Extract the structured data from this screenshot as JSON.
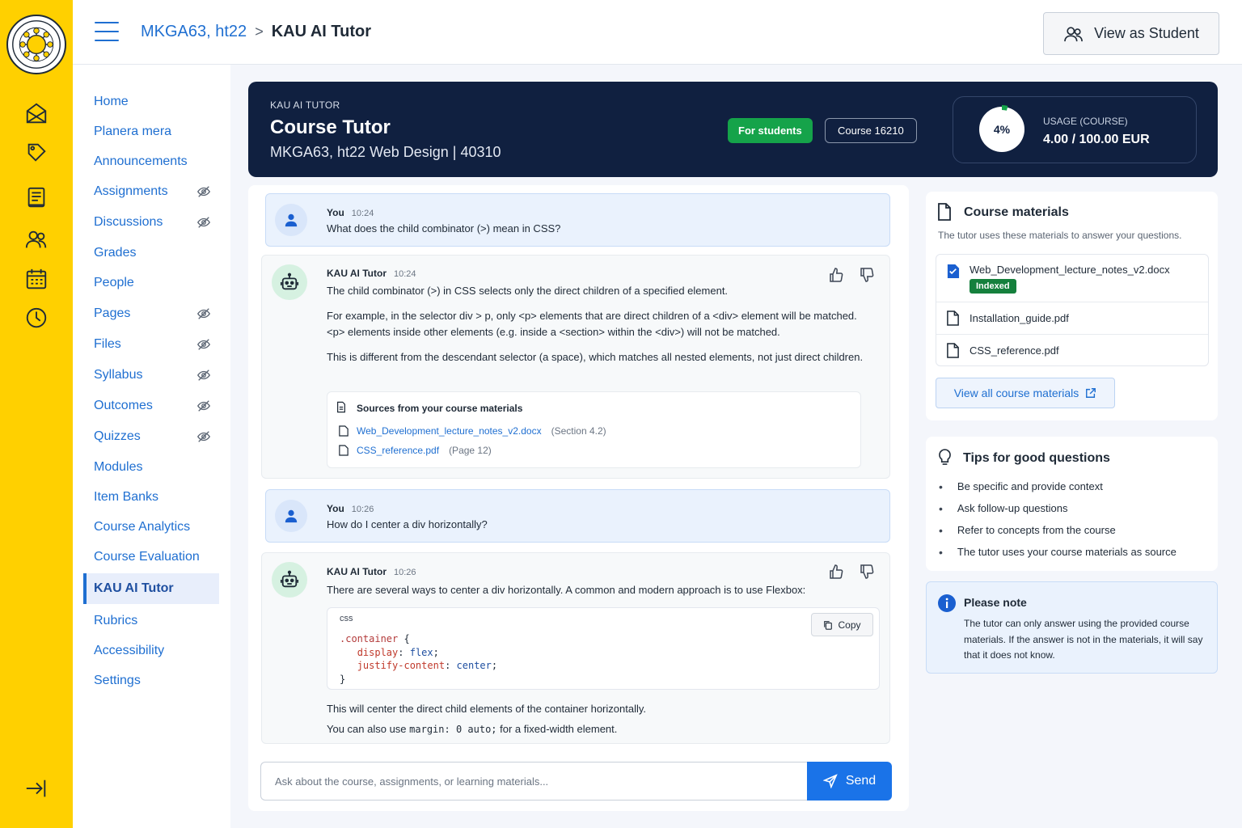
{
  "header": {
    "breadcrumb_course": "MKGA63, ht22",
    "breadcrumb_separator": ">",
    "breadcrumb_current": "KAU AI Tutor",
    "view_as_student": "View as Student"
  },
  "rail": {
    "icons": [
      "account-icon",
      "admin-icon",
      "dashboard-icon",
      "courses-icon",
      "groups-icon",
      "calendar-icon",
      "history-icon",
      "collapse-icon"
    ]
  },
  "course_nav": {
    "items": [
      {
        "label": "Home",
        "hidden": false
      },
      {
        "label": "Planera mera",
        "hidden": false
      },
      {
        "label": "Announcements",
        "hidden": false
      },
      {
        "label": "Assignments",
        "hidden": true
      },
      {
        "label": "Discussions",
        "hidden": true
      },
      {
        "label": "Grades",
        "hidden": false
      },
      {
        "label": "People",
        "hidden": false
      },
      {
        "label": "Pages",
        "hidden": true
      },
      {
        "label": "Files",
        "hidden": true
      },
      {
        "label": "Syllabus",
        "hidden": true
      },
      {
        "label": "Outcomes",
        "hidden": true
      },
      {
        "label": "Quizzes",
        "hidden": true
      },
      {
        "label": "Modules",
        "hidden": false
      },
      {
        "label": "Item Banks",
        "hidden": false
      },
      {
        "label": "Course Analytics",
        "hidden": false
      },
      {
        "label": "Course Evaluation",
        "hidden": false
      },
      {
        "label": "KAU AI Tutor",
        "hidden": false,
        "active": true
      },
      {
        "label": "Rubrics",
        "hidden": false
      },
      {
        "label": "Accessibility",
        "hidden": false
      },
      {
        "label": "Settings",
        "hidden": false
      }
    ]
  },
  "hero": {
    "kicker": "KAU AI TUTOR",
    "title": "Course Tutor",
    "subtitle": "MKGA63, ht22 Web Design | 40310",
    "badge_students": "For students",
    "badge_course": "Course 16210",
    "usage_percent_label": "4%",
    "usage_fraction": 0.04,
    "usage_label": "USAGE (COURSE)",
    "usage_value": "4.00 / 100.00 EUR"
  },
  "chat": {
    "messages": [
      {
        "author": "You",
        "time": "10:24",
        "text": "What does the child combinator (>) mean in CSS?"
      },
      {
        "author": "KAU AI Tutor",
        "time": "10:24",
        "p1": "The child combinator (>) in CSS selects only the direct children of a specified element.",
        "p2": "For example, in the selector div > p, only <p> elements that are direct children of a <div> element will be matched. <p> elements inside other elements (e.g. inside a <section> within the <div>) will not be matched.",
        "p3": "This is different from the descendant selector (a space), which matches all nested elements, not just direct children.",
        "sources_title": "Sources from your course materials",
        "sources": [
          {
            "file": "Web_Development_lecture_notes_v2.docx",
            "note": "(Section 4.2)"
          },
          {
            "file": "CSS_reference.pdf",
            "note": "(Page 12)"
          }
        ]
      },
      {
        "author": "You",
        "time": "10:26",
        "text": "How do I center a div horizontally?"
      },
      {
        "author": "KAU AI Tutor",
        "time": "10:26",
        "p1_a": "There are several ways to center a ",
        "p1_b": "div",
        "p1_c": " horizontally. A common and modern approach is to use Flexbox:",
        "code_lang": "css",
        "copy_label": "Copy",
        "code": {
          "selector": ".container",
          "open": " {",
          "prop1": "display",
          "val1": "flex",
          "prop2": "justify-content",
          "val2": "center",
          "close": "}"
        },
        "p2": "This will center the direct child elements of the container horizontally.",
        "p3_a": "You can also use ",
        "p3_code": "margin: 0 auto;",
        "p3_b": " for a fixed-width element."
      }
    ],
    "input_placeholder": "Ask about the course, assignments, or learning materials...",
    "send_label": "Send"
  },
  "materials": {
    "title": "Course materials",
    "subtitle": "The tutor uses these materials to answer your questions.",
    "files": [
      {
        "name": "Web_Development_lecture_notes_v2.docx",
        "badge": "Indexed"
      },
      {
        "name": "Installation_guide.pdf"
      },
      {
        "name": "CSS_reference.pdf"
      }
    ],
    "view_all": "View all course materials"
  },
  "tips": {
    "title": "Tips for good questions",
    "items": [
      "Be specific and provide context",
      "Ask follow-up questions",
      "Refer to concepts from the course",
      "The tutor uses your course materials as source"
    ]
  },
  "note": {
    "title": "Please note",
    "text": "The tutor can only answer using the provided course materials. If the answer is not in the materials, it will say that it does not know."
  },
  "colors": {
    "rail": "#ffd000",
    "link": "#1f6fd1",
    "hero": "#102040",
    "success": "#15a34a",
    "primary_button": "#1a73e8"
  }
}
